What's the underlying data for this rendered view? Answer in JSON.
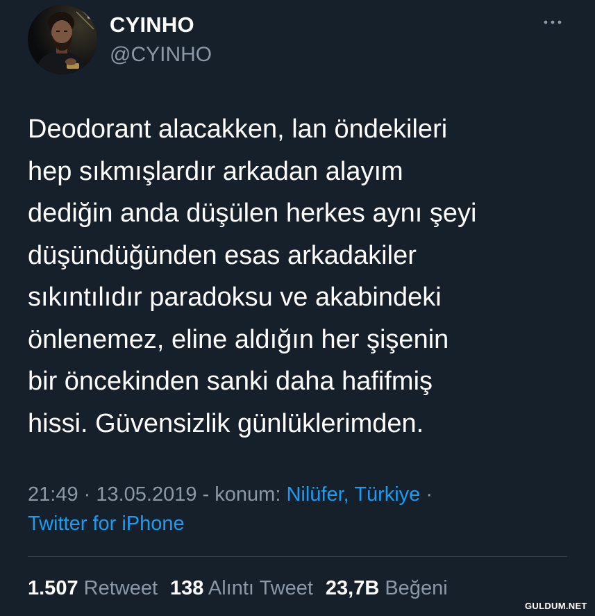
{
  "user": {
    "display_name": "CYINHO",
    "handle": "@CYINHO",
    "avatar_icon": "profile-photo"
  },
  "tweet": {
    "text": "Deodorant alacakken, lan öndekileri\nhep sıkmışlardır arkadan alayım\ndediğin anda düşülen herkes aynı şeyi\ndüşündüğünden esas arkadakiler\nsıkıntılıdır paradoksu ve akabindeki\nönlenemez, eline aldığın her şişenin\nbir öncekinden sanki daha hafifmiş\nhissi. Güvensizlik günlüklerimden."
  },
  "meta": {
    "time": "21:49",
    "sep1": " · ",
    "date": "13.05.2019",
    "location_prefix": " - konum: ",
    "location": "Nilüfer, Türkiye",
    "sep2": " ·",
    "source": "Twitter for iPhone"
  },
  "stats": {
    "retweets_count": "1.507",
    "retweets_label": "Retweet",
    "quotes_count": "138",
    "quotes_label": "Alıntı Tweet",
    "likes_count": "23,7B",
    "likes_label": "Beğeni"
  },
  "icons": {
    "more": "more-horizontal-icon"
  },
  "watermark": "GULDUM.NET",
  "colors": {
    "background": "#15202b",
    "text": "#ffffff",
    "secondary": "#8b98a5",
    "link": "#1d9bf0",
    "divider": "#38444d"
  }
}
